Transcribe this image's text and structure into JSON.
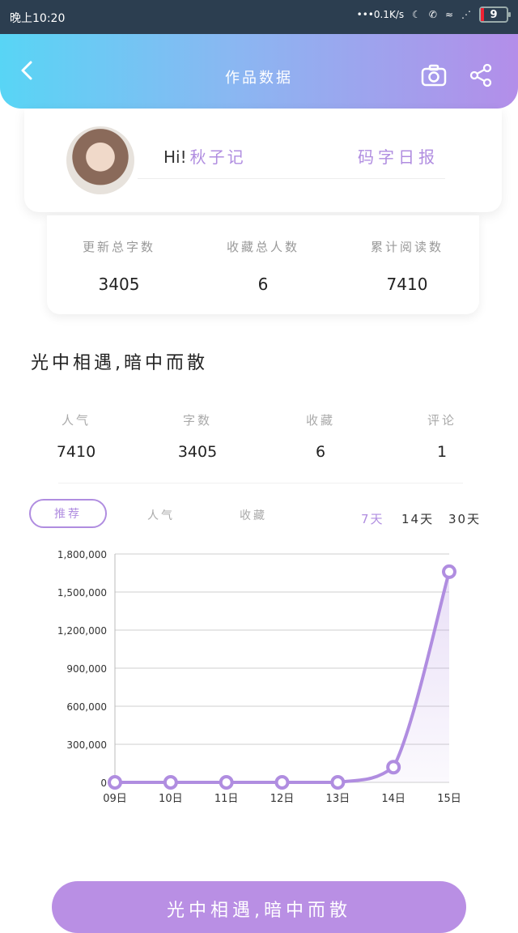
{
  "status_bar": {
    "time": "晚上10:20",
    "network_speed": "0.1K/s",
    "battery": "9"
  },
  "header": {
    "title": "作品数据",
    "icons": [
      "back-icon",
      "camera-icon",
      "share-icon"
    ]
  },
  "profile": {
    "greeting": "Hi!",
    "name": "秋子记",
    "daily_report": "码字日报"
  },
  "totals": [
    {
      "label": "更新总字数",
      "value": "3405"
    },
    {
      "label": "收藏总人数",
      "value": "6"
    },
    {
      "label": "累计阅读数",
      "value": "7410"
    }
  ],
  "work": {
    "title": "光中相遇,暗中而散",
    "metrics": [
      {
        "label": "人气",
        "value": "7410"
      },
      {
        "label": "字数",
        "value": "3405"
      },
      {
        "label": "收藏",
        "value": "6"
      },
      {
        "label": "评论",
        "value": "1"
      }
    ]
  },
  "tabs": {
    "active": "推荐",
    "others": [
      "人气",
      "收藏"
    ]
  },
  "ranges": {
    "options": [
      "7天",
      "14天",
      "30天"
    ],
    "selected": "7天"
  },
  "colors": {
    "accent": "#b08de0",
    "header_start": "#58d5f5",
    "header_end": "#b38ee9"
  },
  "chart_data": {
    "type": "area",
    "categories": [
      "09日",
      "10日",
      "11日",
      "12日",
      "13日",
      "14日",
      "15日"
    ],
    "values": [
      0,
      0,
      0,
      0,
      0,
      120000,
      1660000
    ],
    "yticks": [
      "0",
      "300,000",
      "600,000",
      "900,000",
      "1,200,000",
      "1,500,000",
      "1,800,000"
    ],
    "ylim": [
      0,
      1800000
    ],
    "grid": true
  },
  "bottom_button": {
    "label": "光中相遇,暗中而散"
  }
}
